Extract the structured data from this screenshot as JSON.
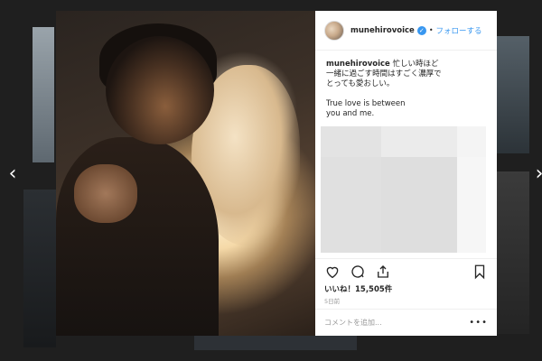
{
  "post": {
    "username": "munehirovoice",
    "verified_icon": "verified-badge-icon",
    "separator": "•",
    "follow_label": "フォローする",
    "caption_username": "munehirovoice",
    "caption_text": "忙しい時ほど\n一緒に過ごす時間はすごく濃厚で\nとっても愛おしい。",
    "caption_extra": "True love is between\nyou and me.",
    "likes_label": "いいね！15,505件",
    "time_label": "5日前",
    "comment_placeholder": "コメントを追加...",
    "more_label": "•••"
  },
  "navigation": {
    "prev_label": "‹",
    "next_label": "›"
  },
  "icons": {
    "like": "heart-icon",
    "comment": "comment-icon",
    "share": "share-icon",
    "save": "bookmark-icon"
  },
  "colors": {
    "link": "#3897f0",
    "text": "#262626",
    "muted": "#999999"
  }
}
